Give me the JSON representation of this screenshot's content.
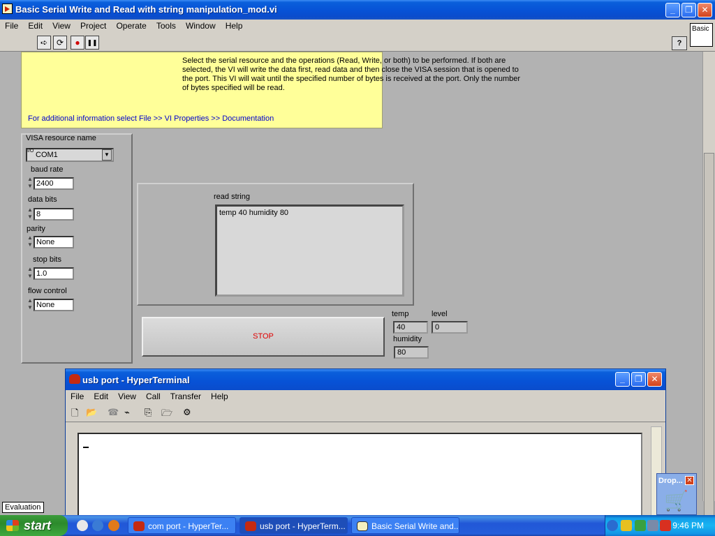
{
  "window": {
    "title": "Basic Serial Write and Read with string manipulation_mod.vi",
    "controls": {
      "minimize": "_",
      "restore": "❐",
      "close": "✕"
    }
  },
  "menubar": [
    "File",
    "Edit",
    "View",
    "Project",
    "Operate",
    "Tools",
    "Window",
    "Help"
  ],
  "toolbar": {
    "run_icon": "➪",
    "run_cont_icon": "⟳",
    "abort_icon": "●",
    "pause_icon": "❚❚",
    "help_icon": "?",
    "basic_label": "Basic"
  },
  "note": {
    "description": "Select the serial resource and the operations (Read, Write, or both) to be performed.  If both are selected, the VI will write the data first, read data and then close the VISA session that is opened to the port.  This VI will wait until the specified number of bytes is received at the port. Only the number of bytes specified will be read.",
    "info": "For additional information select File >> VI Properties >> Documentation"
  },
  "config": {
    "visa_label": "VISA resource name",
    "visa_prefix": "I/O",
    "visa_value": "COM1",
    "baud_label": "baud rate",
    "baud_value": "2400",
    "databits_label": "data bits",
    "databits_value": "8",
    "parity_label": "parity",
    "parity_value": "None",
    "stopbits_label": "stop bits",
    "stopbits_value": "1.0",
    "flow_label": "flow control",
    "flow_value": "None"
  },
  "read": {
    "label": "read string",
    "value": "temp 40 humidity 80"
  },
  "stop_label": "STOP",
  "indicators": {
    "temp_label": "temp",
    "temp_value": "40",
    "level_label": "level",
    "level_value": "0",
    "humidity_label": "humidity",
    "humidity_value": "80"
  },
  "eval_label": "Evaluation",
  "hyperterminal": {
    "title": "usb port - HyperTerminal",
    "menu": [
      "File",
      "Edit",
      "View",
      "Call",
      "Transfer",
      "Help"
    ],
    "tool_icons": [
      "🗋",
      "📂",
      "☎",
      "⌁",
      "⎘",
      "🗁",
      "⚙"
    ]
  },
  "dropbox": {
    "label": "Drop...",
    "close": "✕"
  },
  "taskbar": {
    "start": "start",
    "tasks": [
      {
        "label": "com port - HyperTer...",
        "active": false
      },
      {
        "label": "usb port - HyperTerm...",
        "active": true
      },
      {
        "label": "Basic Serial Write and...",
        "active": false
      }
    ],
    "clock": "9:46 PM"
  }
}
